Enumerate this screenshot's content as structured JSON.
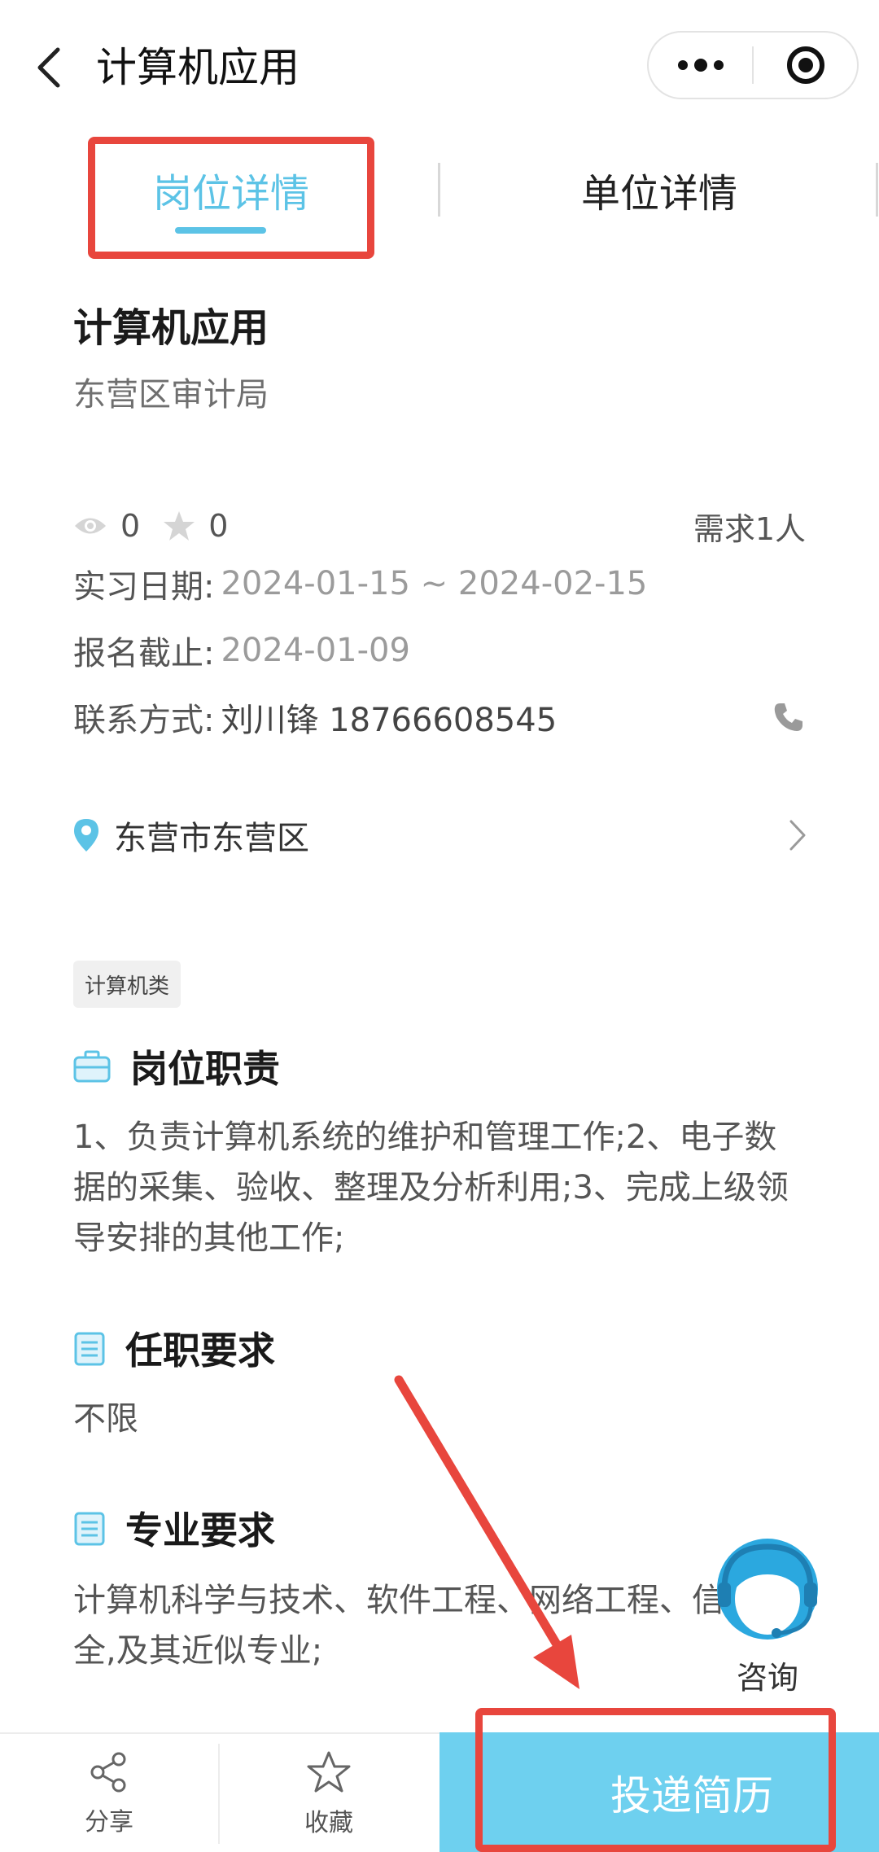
{
  "header": {
    "title": "计算机应用",
    "back_icon": "back-arrow-icon",
    "more_icon": "more-dots-icon",
    "close_icon": "mini-program-close-icon"
  },
  "tabs": [
    {
      "label": "岗位详情",
      "active": true
    },
    {
      "label": "单位详情",
      "active": false
    }
  ],
  "job": {
    "title": "计算机应用",
    "company": "东营区审计局",
    "views": "0",
    "favorites": "0",
    "need": "需求1人",
    "internship_label": "实习日期:",
    "internship_value": "2024-01-15 ~ 2024-02-15",
    "deadline_label": "报名截止:",
    "deadline_value": "2024-01-09",
    "contact_label": "联系方式:",
    "contact_value": "刘川锋 18766608545",
    "location": "东营市东营区",
    "tag": "计算机类"
  },
  "sections": {
    "duties": {
      "title": "岗位职责",
      "lines": [
        "1、负责计算机系统的维护和管理工作;2、电子数",
        "据的采集、验收、整理及分析利用;3、完成上级领",
        "导安排的其他工作;"
      ]
    },
    "requirements": {
      "title": "任职要求",
      "text": "不限"
    },
    "majors": {
      "title": "专业要求",
      "lines": [
        "计算机科学与技术、软件工程、网络工程、信息安",
        "全,及其近似专业;"
      ]
    }
  },
  "consult": {
    "label": "咨询"
  },
  "bottom_bar": {
    "share_label": "分享",
    "favorite_label": "收藏",
    "submit_label": "投递简历"
  },
  "colors": {
    "accent": "#5cc3e6",
    "submit_bg": "#6ed0ef",
    "annotation_red": "#e8463d"
  }
}
